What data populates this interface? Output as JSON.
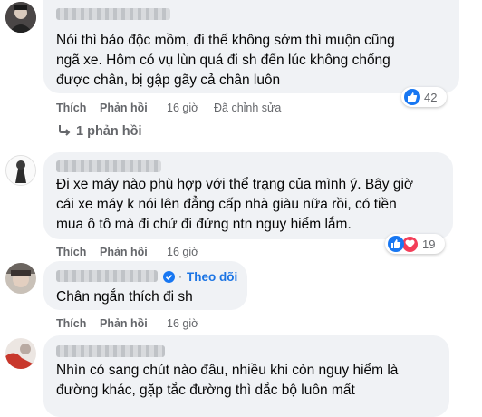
{
  "comments": [
    {
      "text_lines": [
        "Nói thì bảo độc mồm, đi thế không sớm thì muộn cũng",
        "ngã xe. Hôm có vụ lùn quá đi sh đến lúc không chống",
        "được chân, bị gập gãy cả chân luôn"
      ],
      "like_label": "Thích",
      "reply_label": "Phản hồi",
      "time": "16 giờ",
      "edited": "Đã chỉnh sửa",
      "reaction_count": "42",
      "reactions": [
        "like-icon"
      ],
      "replies_label": "1 phản hồi"
    },
    {
      "text_lines": [
        "Đi xe máy nào phù hợp với thể trạng của mình ý. Bây giờ",
        "cái xe máy k nói lên đẳng cấp nhà giàu nữa rồi, có tiền",
        "mua ô tô mà đi chứ đi đứng ntn nguy hiểm lắm."
      ],
      "like_label": "Thích",
      "reply_label": "Phản hồi",
      "time": "16 giờ",
      "reaction_count": "19",
      "reactions": [
        "like-icon",
        "heart-icon"
      ]
    },
    {
      "text_lines": [
        "Chân ngắn thích đi sh"
      ],
      "follow_label": "Theo dõi",
      "like_label": "Thích",
      "reply_label": "Phản hồi",
      "time": "16 giờ"
    },
    {
      "text_lines": [
        "Nhìn có sang chút nào đâu, nhiều khi còn nguy hiểm là",
        "đường khác, gặp tắc đường thì dắc bộ luôn mất"
      ]
    }
  ],
  "colors": {
    "bubble": "#f0f2f5",
    "meta": "#65676b",
    "link_blue": "#1b74e4",
    "like_blue": "#1877f2",
    "heart_red": "#f33e58"
  }
}
